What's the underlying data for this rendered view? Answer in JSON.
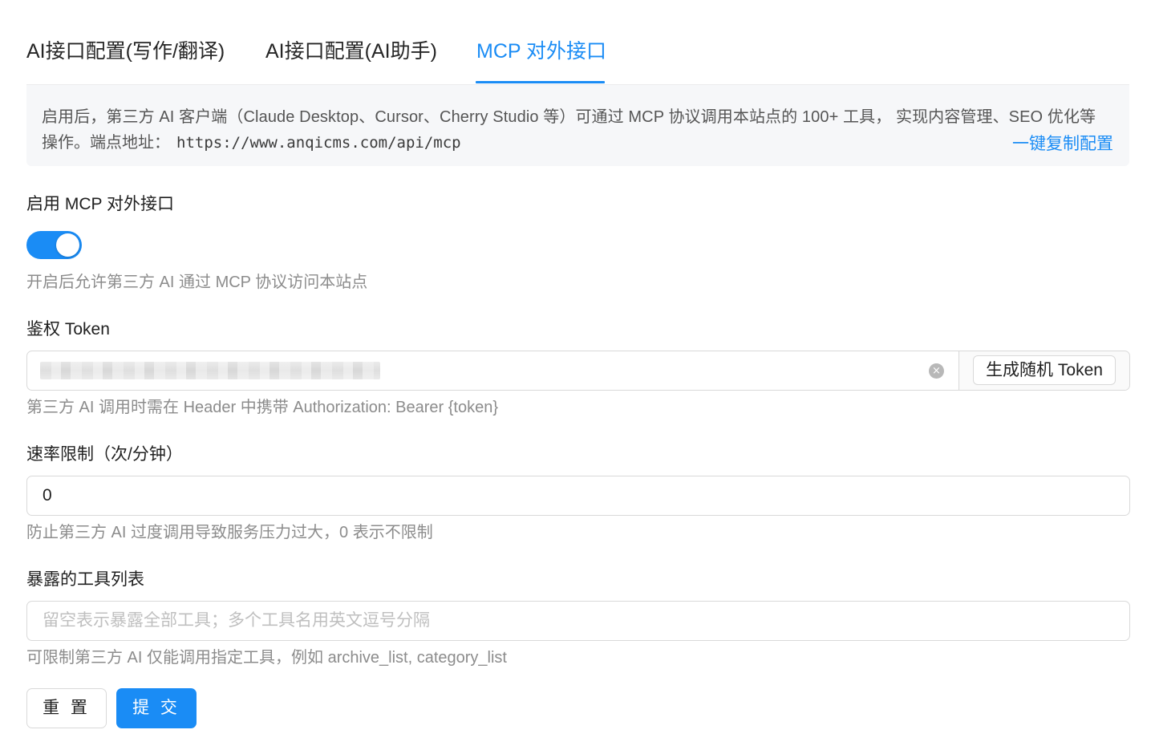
{
  "tabs": [
    {
      "label": "AI接口配置(写作/翻译)",
      "active": false
    },
    {
      "label": "AI接口配置(AI助手)",
      "active": false
    },
    {
      "label": "MCP 对外接口",
      "active": true
    }
  ],
  "notice": {
    "line1": "启用后，第三方 AI 客户端（Claude Desktop、Cursor、Cherry Studio 等）可通过 MCP 协议调用本站点的 100+ 工具， 实现内容管理、SEO 优化等",
    "line2_prefix": "操作。端点地址：",
    "endpoint": "https://www.anqicms.com/api/mcp",
    "copy_link": "一键复制配置"
  },
  "enable": {
    "label": "启用 MCP 对外接口",
    "on": true,
    "help": "开启后允许第三方 AI 通过 MCP 协议访问本站点"
  },
  "token": {
    "label": "鉴权 Token",
    "generate_button": "生成随机 Token",
    "help": "第三方 AI 调用时需在 Header 中携带 Authorization: Bearer {token}"
  },
  "rate_limit": {
    "label": "速率限制（次/分钟）",
    "value": "0",
    "help": "防止第三方 AI 过度调用导致服务压力过大，0 表示不限制"
  },
  "tools": {
    "label": "暴露的工具列表",
    "placeholder": "留空表示暴露全部工具；多个工具名用英文逗号分隔",
    "help": "可限制第三方 AI 仅能调用指定工具，例如 archive_list, category_list"
  },
  "actions": {
    "reset": "重 置",
    "submit": "提 交"
  },
  "colors": {
    "primary": "#1a8cf5",
    "help_text": "#8c8c8c",
    "notice_bg": "#f6f7f9"
  }
}
